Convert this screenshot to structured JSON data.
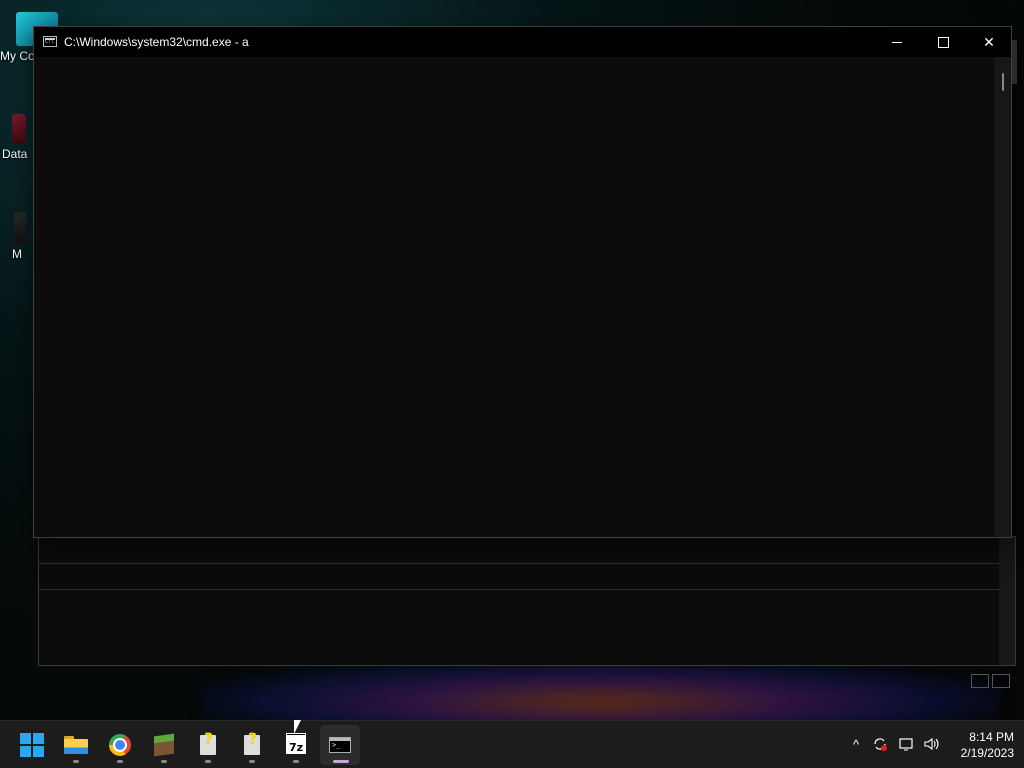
{
  "desktop": {
    "icons": [
      {
        "label": "My Co",
        "icon": "this-pc-icon"
      },
      {
        "label": "Data",
        "icon": "shortcut-app-icon"
      },
      {
        "label": "M",
        "icon": "shortcut-app-icon"
      }
    ]
  },
  "cmd_window": {
    "title": "C:\\Windows\\system32\\cmd.exe - a",
    "icon": "cmd-icon",
    "controls": {
      "minimize": "minimize-icon",
      "maximize": "maximize-icon",
      "close": "close-icon",
      "close_glyph": "✕"
    },
    "console_text": ""
  },
  "taskbar": {
    "apps": [
      {
        "name": "start",
        "icon": "windows-start-icon",
        "running": false
      },
      {
        "name": "file-explorer",
        "icon": "folder-icon",
        "running": true
      },
      {
        "name": "chrome",
        "icon": "chrome-icon",
        "running": true
      },
      {
        "name": "minecraft",
        "icon": "grass-block-icon",
        "running": true
      },
      {
        "name": "unknown-app-1",
        "icon": "unknown-file-icon",
        "running": true
      },
      {
        "name": "unknown-app-2",
        "icon": "unknown-file-icon",
        "running": true
      },
      {
        "name": "7-zip",
        "icon": "7zip-icon",
        "label": "7z",
        "running": true
      },
      {
        "name": "command-prompt",
        "icon": "cmd-icon",
        "running": true,
        "active": true
      }
    ],
    "tray": {
      "overflow_glyph": "^",
      "icons": [
        "chevron-up-icon",
        "sync-icon",
        "network-icon",
        "volume-icon"
      ],
      "time": "8:14 PM",
      "date": "2/19/2023"
    }
  }
}
